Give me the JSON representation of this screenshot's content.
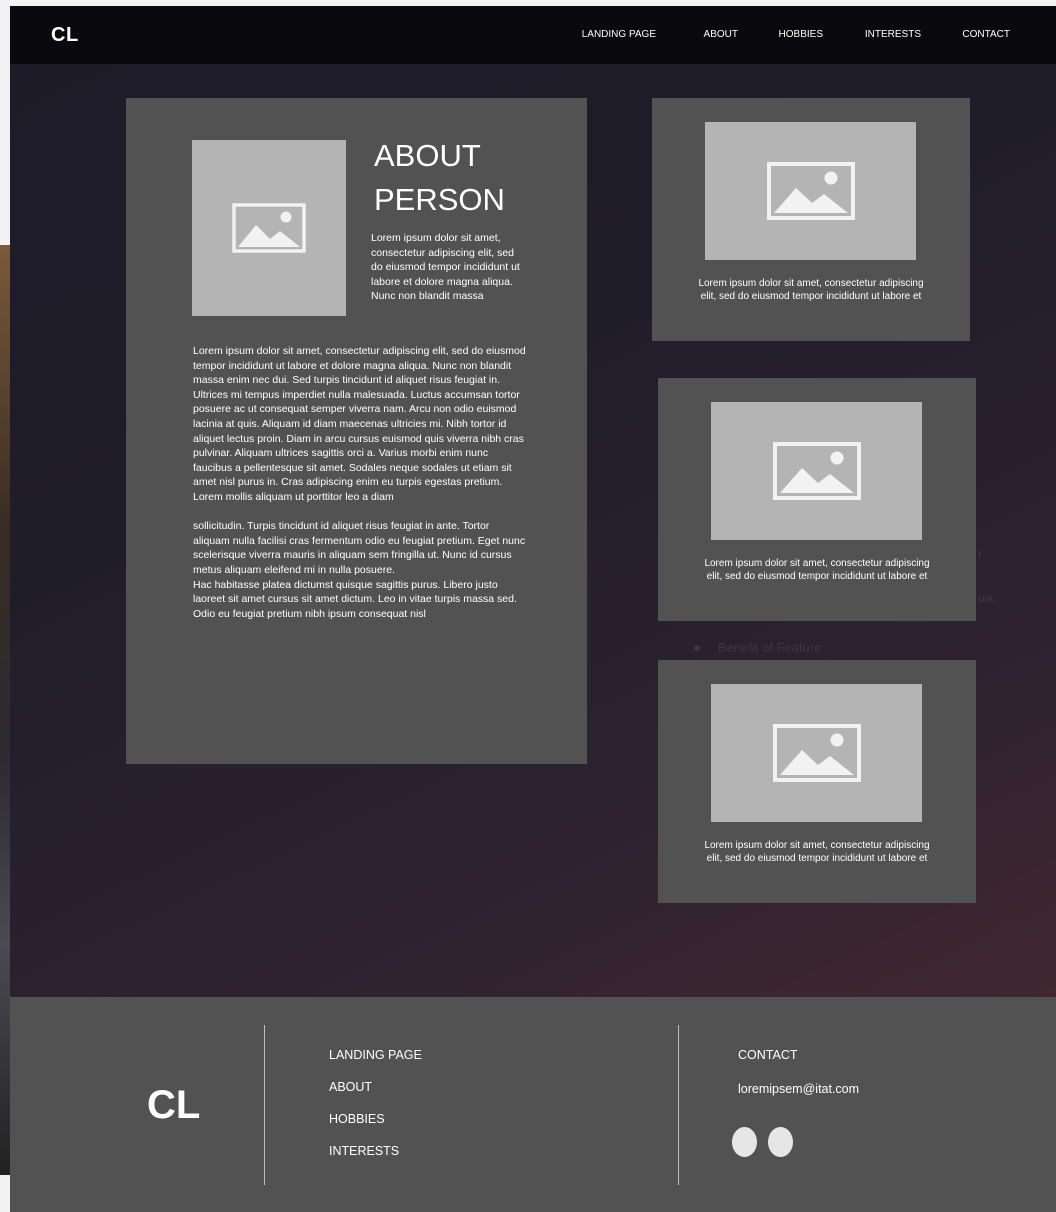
{
  "header": {
    "logo": "CL",
    "nav": [
      "LANDING PAGE",
      "ABOUT",
      "HOBBIES",
      "INTERESTS",
      "CONTACT"
    ]
  },
  "background_ghost": {
    "text_a": "r",
    "text_b": "ua.",
    "bullet": "Benefit of Feature"
  },
  "about": {
    "title_line1": "ABOUT",
    "title_line2": "PERSON",
    "intro": "Lorem ipsum dolor sit amet, consectetur adipiscing elit, sed do eiusmod tempor incididunt ut labore et dolore magna aliqua. Nunc non blandit massa",
    "body_p1": "Lorem ipsum dolor sit amet, consectetur adipiscing elit, sed do eiusmod tempor incididunt ut labore et dolore magna aliqua. Nunc non blandit massa enim nec dui. Sed turpis tincidunt id aliquet risus feugiat in. Ultrices mi tempus imperdiet nulla malesuada. Luctus accumsan tortor posuere ac ut consequat semper viverra nam. Arcu non odio euismod lacinia at quis. Aliquam id diam maecenas ultricies mi. Nibh tortor id aliquet lectus proin. Diam in arcu cursus euismod quis viverra nibh cras pulvinar. Aliquam ultrices sagittis orci a. Varius morbi enim nunc faucibus a pellentesque sit amet. Sodales neque sodales ut etiam sit amet nisl purus in. Cras adipiscing enim eu turpis egestas pretium. Lorem mollis aliquam ut porttitor leo a diam",
    "body_p2": "sollicitudin. Turpis tincidunt id aliquet risus feugiat in ante. Tortor aliquam nulla facilisi cras fermentum odio eu feugiat pretium. Eget nunc scelerisque viverra mauris in aliquam sem fringilla ut. Nunc id cursus metus aliquam eleifend mi in nulla posuere.",
    "body_p3": "Hac habitasse platea dictumst quisque sagittis purus. Libero justo laoreet sit amet cursus sit amet dictum. Leo in vitae turpis massa sed. Odio eu feugiat pretium nibh ipsum consequat nisl"
  },
  "features": [
    {
      "text": "Lorem ipsum dolor sit amet, consectetur adipiscing elit, sed do eiusmod tempor incididunt ut labore et"
    },
    {
      "text": "Lorem ipsum dolor sit amet, consectetur adipiscing elit, sed do eiusmod tempor incididunt ut labore et"
    },
    {
      "text": "Lorem ipsum dolor sit amet, consectetur adipiscing elit, sed do eiusmod tempor incididunt ut labore et"
    }
  ],
  "footer": {
    "logo": "CL",
    "links": [
      "LANDING PAGE",
      "ABOUT",
      "HOBBIES",
      "INTERESTS"
    ],
    "contact_heading": "CONTACT",
    "email": "loremipsem@itat.com",
    "social_icons": [
      "social-icon-1",
      "social-icon-2"
    ]
  },
  "colors": {
    "header_bg": "#0a0a0e",
    "card_bg": "#525252",
    "image_placeholder": "#b4b4b4",
    "footer_bg": "#525252"
  }
}
